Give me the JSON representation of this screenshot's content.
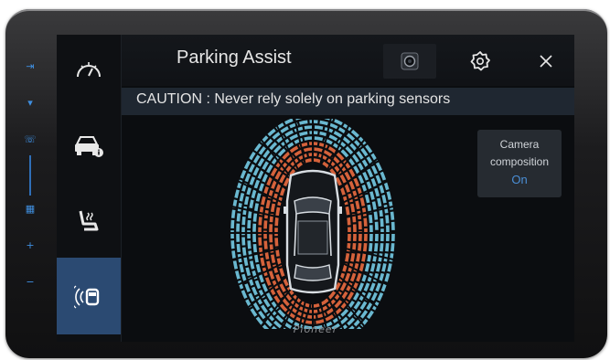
{
  "header": {
    "title": "Parking Assist",
    "camera_button": "camera-view-icon",
    "settings_button": "gear-icon",
    "close_button": "close-icon"
  },
  "caution": {
    "text": "CAUTION : Never rely solely on parking sensors"
  },
  "sidebar": {
    "items": [
      {
        "icon": "speedometer-icon",
        "active": false
      },
      {
        "icon": "car-info-icon",
        "active": false
      },
      {
        "icon": "seat-heater-icon",
        "active": false
      },
      {
        "icon": "parking-sensor-icon",
        "active": true
      }
    ]
  },
  "camera_composition": {
    "line1": "Camera",
    "line2": "composition",
    "value": "On"
  },
  "brand": {
    "text": "Pioneer"
  },
  "hardware_keys": [
    "input-icon",
    "mic-icon",
    "phone-icon",
    "apps-icon",
    "volume-up-icon",
    "volume-down-icon"
  ],
  "colors": {
    "active_accent": "#2b4a72",
    "value_blue": "#4a8fd6",
    "sensor_near": "#e0673e",
    "sensor_far": "#74cbe6"
  }
}
